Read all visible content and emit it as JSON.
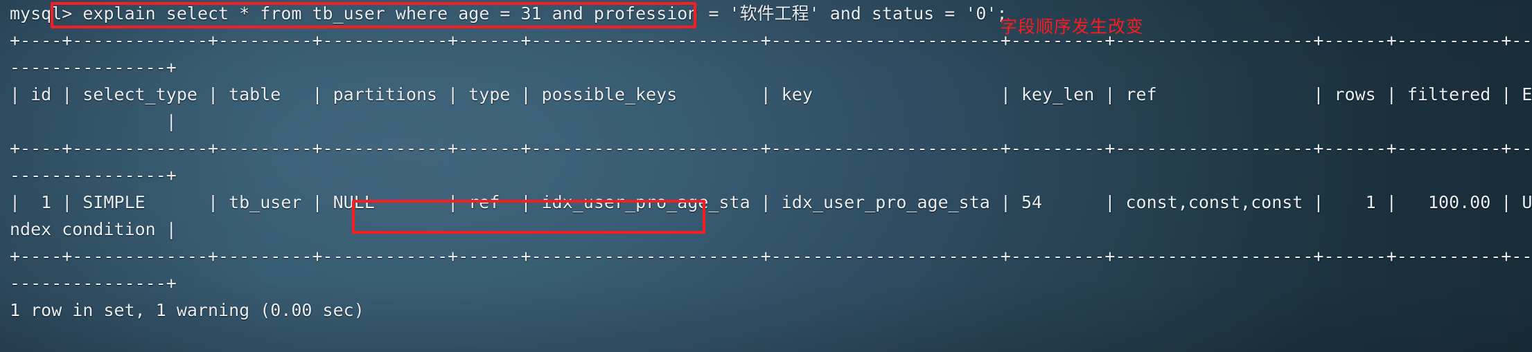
{
  "window": {
    "title": "mysql-client-terminal",
    "background_color": "#2c4a60",
    "text_color": "#e9eef2"
  },
  "prompt": {
    "label": "mysql>",
    "query": "explain select * from tb_user where age = 31 and profession = '软件工程' and status = '0';"
  },
  "annotations": {
    "note_text": "字段顺序发生改变",
    "note_color": "#fa1c21",
    "box_color": "#f71d21",
    "query_box_name": "query-highlight-box",
    "index_box_name": "index-highlight-box"
  },
  "explain_table": {
    "separator_line_1": "+----+-------------+---------+------------+------+----------------------+----------------------+---------+-------------------+------+----------+-------------",
    "separator_line_1_wrap": "---------------+",
    "header_line": "| id | select_type | table   | partitions | type | possible_keys        | key                  | key_len | ref               | rows | filtered | Extra",
    "header_line_wrap": "               |",
    "separator_line_2": "+----+-------------+---------+------------+------+----------------------+----------------------+---------+-------------------+------+----------+-------------",
    "separator_line_2_wrap": "---------------+",
    "row_line": "|  1 | SIMPLE      | tb_user | NULL       | ref  | idx_user_pro_age_sta | idx_user_pro_age_sta | 54      | const,const,const |    1 |   100.00 | Using i",
    "row_line_wrap": "ndex condition |",
    "separator_line_3": "+----+-------------+---------+------------+------+----------------------+----------------------+---------+-------------------+------+----------+-------------",
    "separator_line_3_wrap": "---------------+",
    "columns": [
      "id",
      "select_type",
      "table",
      "partitions",
      "type",
      "possible_keys",
      "key",
      "key_len",
      "ref",
      "rows",
      "filtered",
      "Extra"
    ],
    "rows": [
      {
        "id": "1",
        "select_type": "SIMPLE",
        "table": "tb_user",
        "partitions": "NULL",
        "type": "ref",
        "possible_keys": "idx_user_pro_age_sta",
        "key": "idx_user_pro_age_sta",
        "key_len": "54",
        "ref": "const,const,const",
        "rows": "1",
        "filtered": "100.00",
        "Extra": "Using index condition"
      }
    ]
  },
  "status": {
    "result_line": "1 row in set, 1 warning (0.00 sec)"
  }
}
